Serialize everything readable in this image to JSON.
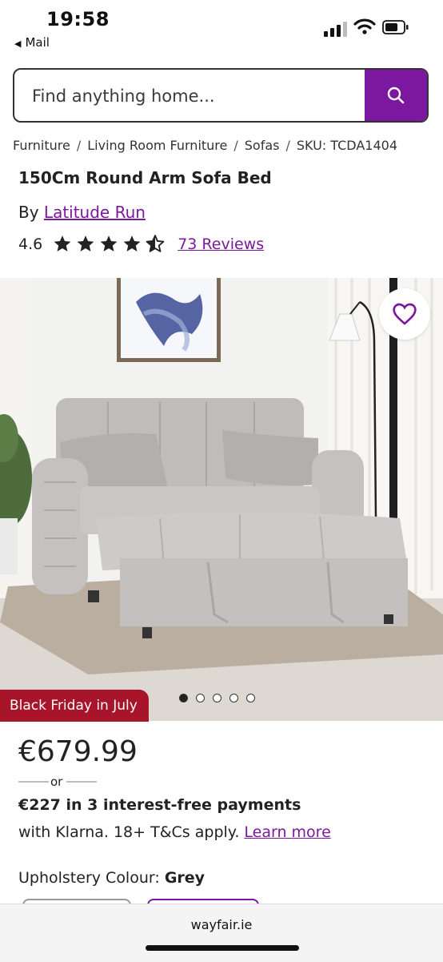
{
  "status_bar": {
    "time": "19:58",
    "back_app": "Mail"
  },
  "search": {
    "placeholder": "Find anything home..."
  },
  "breadcrumb": {
    "items": [
      "Furniture",
      "Living Room Furniture",
      "Sofas",
      "SKU: TCDA1404"
    ],
    "separator": "/"
  },
  "product": {
    "title": "150Cm Round Arm Sofa Bed",
    "by_label": "By",
    "brand": "Latitude Run",
    "rating": "4.6",
    "stars_filled": 4.5,
    "stars_total": 5,
    "reviews_link": "73 Reviews"
  },
  "gallery": {
    "promo_badge": "Black Friday in July",
    "image_count": 5,
    "active_index": 0
  },
  "pricing": {
    "price": "€679.99",
    "or_label": "or",
    "klarna_line1": "€227 in 3 interest-free payments",
    "klarna_line2": "with Klarna. 18+ T&Cs apply.",
    "learn_more": "Learn more"
  },
  "options": {
    "upholstery_label": "Upholstery Colour:",
    "upholstery_value": "Grey"
  },
  "browser": {
    "url": "wayfair.ie"
  },
  "colors": {
    "brand_purple": "#7b189f",
    "promo_red": "#a8142a"
  }
}
